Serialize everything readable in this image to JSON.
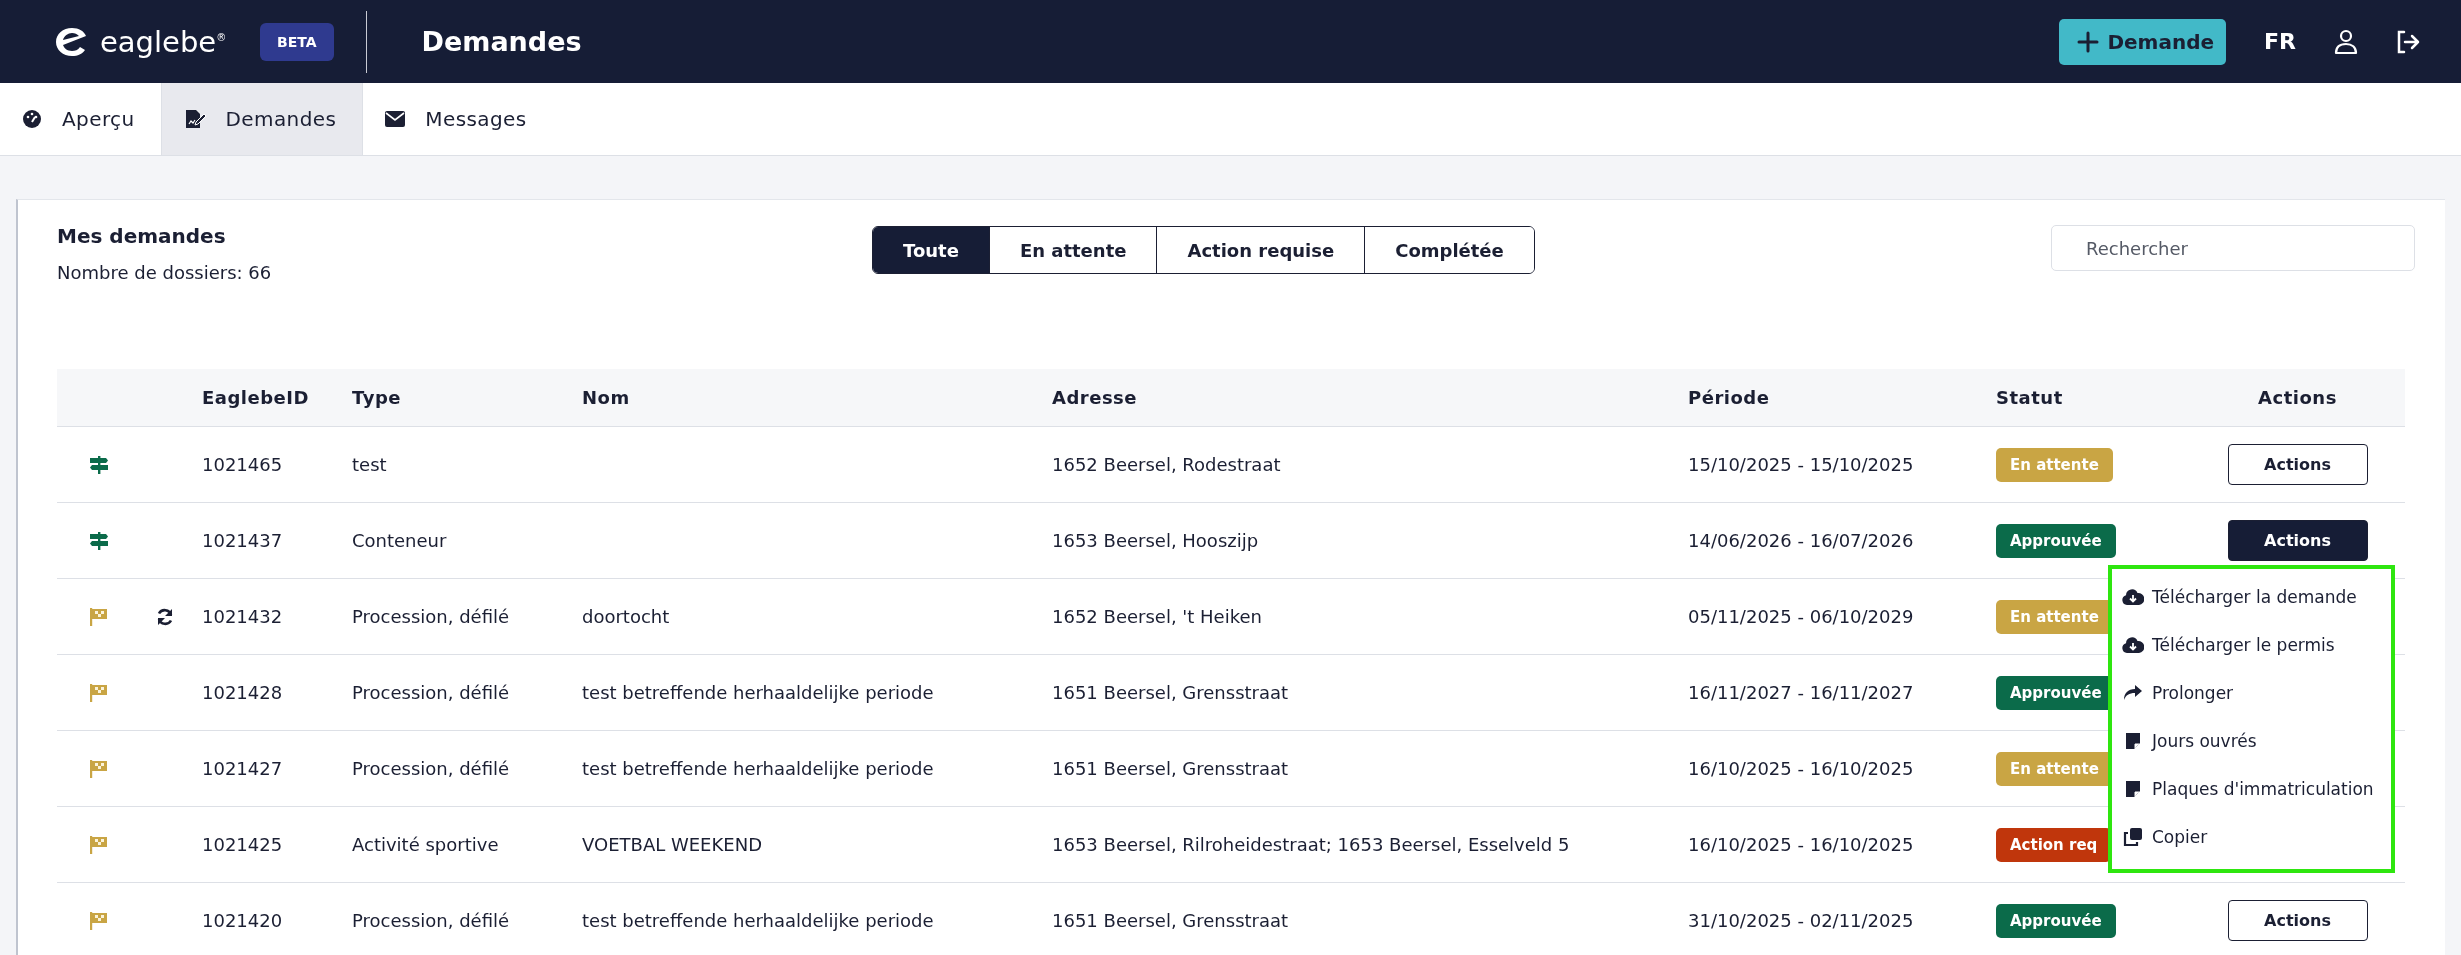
{
  "header": {
    "logo": {
      "text": "eaglebe",
      "mark": "®"
    },
    "badge": "BETA",
    "title": "Demandes",
    "new_button": "Demande",
    "language": "FR"
  },
  "nav": [
    {
      "label": "Aperçu",
      "selected": false
    },
    {
      "label": "Demandes",
      "selected": true
    },
    {
      "label": "Messages",
      "selected": false
    }
  ],
  "card": {
    "title": "Mes demandes",
    "count": "Nombre de dossiers: 66",
    "filters": [
      {
        "label": "Toute",
        "selected": true
      },
      {
        "label": "En attente",
        "selected": false
      },
      {
        "label": "Action requise",
        "selected": false
      },
      {
        "label": "Complétée",
        "selected": false
      }
    ],
    "search": {
      "placeholder": "Rechercher"
    }
  },
  "table": {
    "columns": [
      "EaglebeID",
      "Type",
      "Nom",
      "Adresse",
      "Période",
      "Statut",
      "Actions"
    ],
    "rows": [
      {
        "kind": "signpost",
        "recurring": false,
        "id": "1021465",
        "type": "test",
        "address": "1652 Beersel, Rodestraat",
        "period": "15/10/2025 - 15/10/2025",
        "status": {
          "label": "En attente",
          "kind": "pending"
        },
        "action": {
          "label": "Actions",
          "selected": false
        }
      },
      {
        "kind": "signpost",
        "recurring": false,
        "id": "1021437",
        "type": "Conteneur",
        "address": "1653 Beersel, Hooszijp",
        "period": "14/06/2026 - 16/07/2026",
        "status": {
          "label": "Approuvée",
          "kind": "approved"
        },
        "action": {
          "label": "Actions",
          "selected": true
        }
      },
      {
        "kind": "flag",
        "recurring": true,
        "id": "1021432",
        "type": "Procession, défilé",
        "name": "doortocht",
        "address": "1652 Beersel, 't Heiken",
        "period": "05/11/2025 - 06/10/2029",
        "status": {
          "label": "En attente",
          "kind": "pending"
        }
      },
      {
        "kind": "flag",
        "recurring": false,
        "id": "1021428",
        "type": "Procession, défilé",
        "name": "test betreffende herhaaldelijke periode",
        "address": "1651 Beersel, Grensstraat",
        "period": "16/11/2027 - 16/11/2027",
        "status": {
          "label": "Approuvée",
          "kind": "approved"
        }
      },
      {
        "kind": "flag",
        "recurring": false,
        "id": "1021427",
        "type": "Procession, défilé",
        "name": "test betreffende herhaaldelijke periode",
        "address": "1651 Beersel, Grensstraat",
        "period": "16/10/2025 - 16/10/2025",
        "status": {
          "label": "En attente",
          "kind": "pending"
        }
      },
      {
        "kind": "flag",
        "recurring": false,
        "id": "1021425",
        "type": "Activité sportive",
        "name": "VOETBAL WEEKEND",
        "address": "1653 Beersel, Rilroheidestraat; 1653 Beersel, Esselveld 5",
        "period": "16/10/2025 - 16/10/2025",
        "status": {
          "label": "Action req",
          "kind": "action"
        }
      },
      {
        "kind": "flag",
        "recurring": false,
        "id": "1021420",
        "type": "Procession, défilé",
        "name": "test betreffende herhaaldelijke periode",
        "address": "1651 Beersel, Grensstraat",
        "period": "31/10/2025 - 02/11/2025",
        "status": {
          "label": "Approuvée",
          "kind": "approved"
        },
        "action": {
          "label": "Actions",
          "selected": false
        }
      }
    ],
    "menu": {
      "items": [
        {
          "label": "Télécharger la demande"
        },
        {
          "label": "Télécharger le permis"
        },
        {
          "label": "Prolonger"
        },
        {
          "label": "Jours ouvrés"
        },
        {
          "label": "Plaques d'immatriculation"
        },
        {
          "label": "Copier"
        }
      ]
    }
  }
}
